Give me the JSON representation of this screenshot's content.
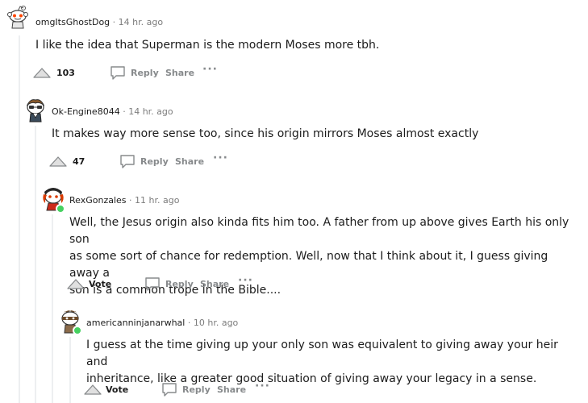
{
  "comments": [
    {
      "username": "omgItsGhostDog",
      "time": "14 hr. ago",
      "body": "I like the idea that Superman is the modern Moses more tbh.",
      "votes": "103",
      "reply": "Reply",
      "share": "Share",
      "more": "···"
    },
    {
      "username": "Ok-Engine8044",
      "time": "14 hr. ago",
      "body": "It makes way more sense too, since his origin mirrors Moses almost exactly",
      "votes": "47",
      "reply": "Reply",
      "share": "Share",
      "more": "···"
    },
    {
      "username": "RexGonzales",
      "time": "11 hr. ago",
      "body_lines": [
        "Well, the Jesus origin also kinda fits him too. A father from up above gives Earth his only son",
        "as some sort of chance for redemption. Well, now that I think about it, I guess giving away a",
        "son is a common trope in the Bible...."
      ],
      "votes": "Vote",
      "reply": "Reply",
      "share": "Share",
      "more": "···",
      "online": true
    },
    {
      "username": "americanninjanarwhal",
      "time": "10 hr. ago",
      "body_lines": [
        "I guess at the time giving up your only son was equivalent to giving away your heir and",
        "inheritance, like a greater good situation of giving away your legacy in a sense."
      ],
      "votes": "Vote",
      "reply": "Reply",
      "share": "Share",
      "more": "···",
      "online": true
    }
  ],
  "separator": "·",
  "icons": {
    "upvote": "upvote-arrow-icon",
    "reply": "speech-bubble-icon",
    "avatar": "snoo-avatar-icon"
  },
  "colors": {
    "meta_gray": "#7c7c7c",
    "action_gray": "#878a8c",
    "online_green": "#46d160",
    "thread_line": "#edeff1"
  }
}
